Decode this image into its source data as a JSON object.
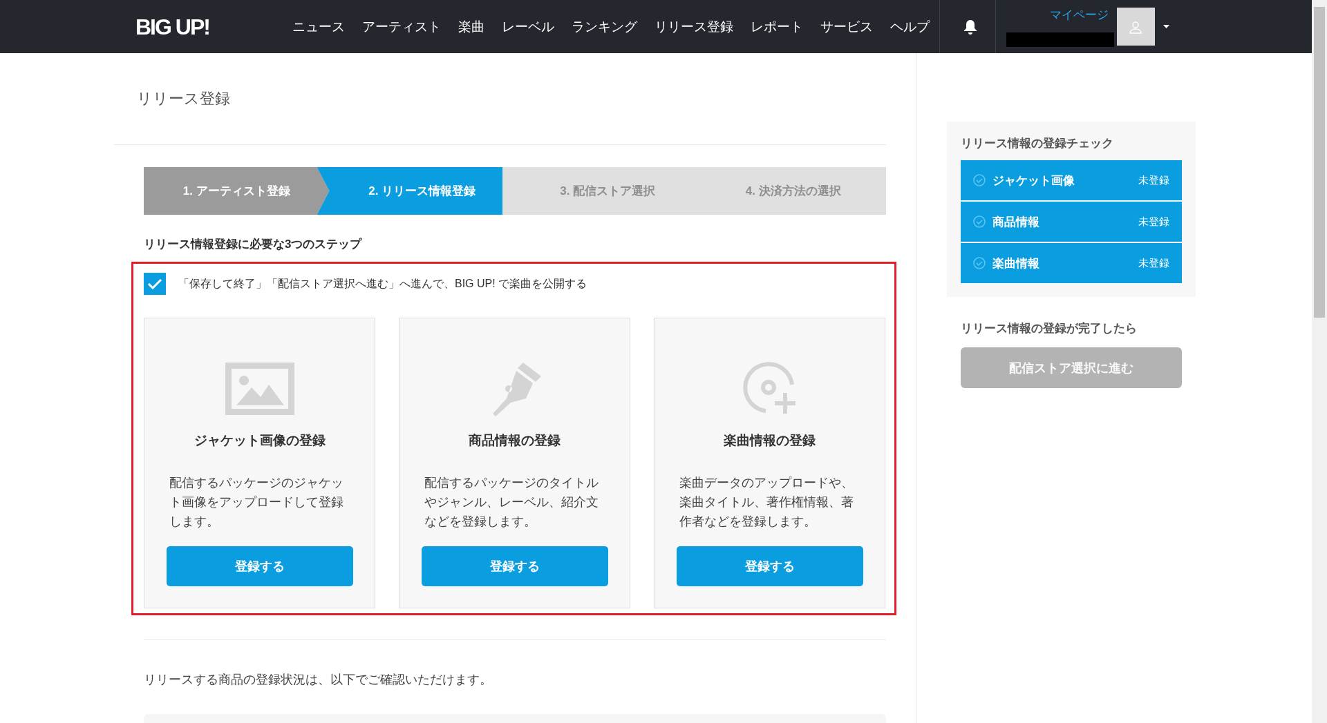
{
  "header": {
    "logo": "BIG UP!",
    "nav": [
      "ニュース",
      "アーティスト",
      "楽曲",
      "レーベル",
      "ランキング",
      "リリース登録",
      "レポート",
      "サービス",
      "ヘルプ"
    ],
    "mypage": "マイページ"
  },
  "page_title": "リリース登録",
  "steps": [
    {
      "label": "1. アーティスト登録",
      "completed": true,
      "selected": false
    },
    {
      "label": "2. リリース情報登録",
      "completed": false,
      "selected": true
    },
    {
      "label": "3. 配信ストア選択",
      "completed": false,
      "selected": false
    },
    {
      "label": "4. 決済方法の選択",
      "completed": false,
      "selected": false
    }
  ],
  "steps_heading": "リリース情報登録に必要な3つのステップ",
  "notice": {
    "checked": true,
    "text": "「保存して終了」「配信ストア選択へ進む」へ進んで、BIG UP! で楽曲を公開する"
  },
  "cards": [
    {
      "kind": "image",
      "title": "ジャケット画像の登録",
      "description": "配信するパッケージのジャケット画像をアップロードして登録します。",
      "button": "登録する"
    },
    {
      "kind": "pen",
      "title": "商品情報の登録",
      "description": "配信するパッケージのタイトルやジャンル、レーベル、紹介文などを登録します。",
      "button": "登録する"
    },
    {
      "kind": "disc",
      "title": "楽曲情報の登録",
      "description": "楽曲データのアップロードや、楽曲タイトル、著作権情報、著作者などを登録します。",
      "button": "登録する"
    }
  ],
  "status_text": "リリースする商品の登録状況は、以下でご確認いただけます。",
  "sidebar": {
    "check_title": "リリース情報の登録チェック",
    "items": [
      {
        "label": "ジャケット画像",
        "status": "未登録",
        "done": false
      },
      {
        "label": "商品情報",
        "status": "未登録",
        "done": false
      },
      {
        "label": "楽曲情報",
        "status": "未登録",
        "done": false
      }
    ],
    "next_heading": "リリース情報の登録が完了したら",
    "next_button": {
      "label": "配信ストア選択に進む",
      "disabled": true
    }
  }
}
